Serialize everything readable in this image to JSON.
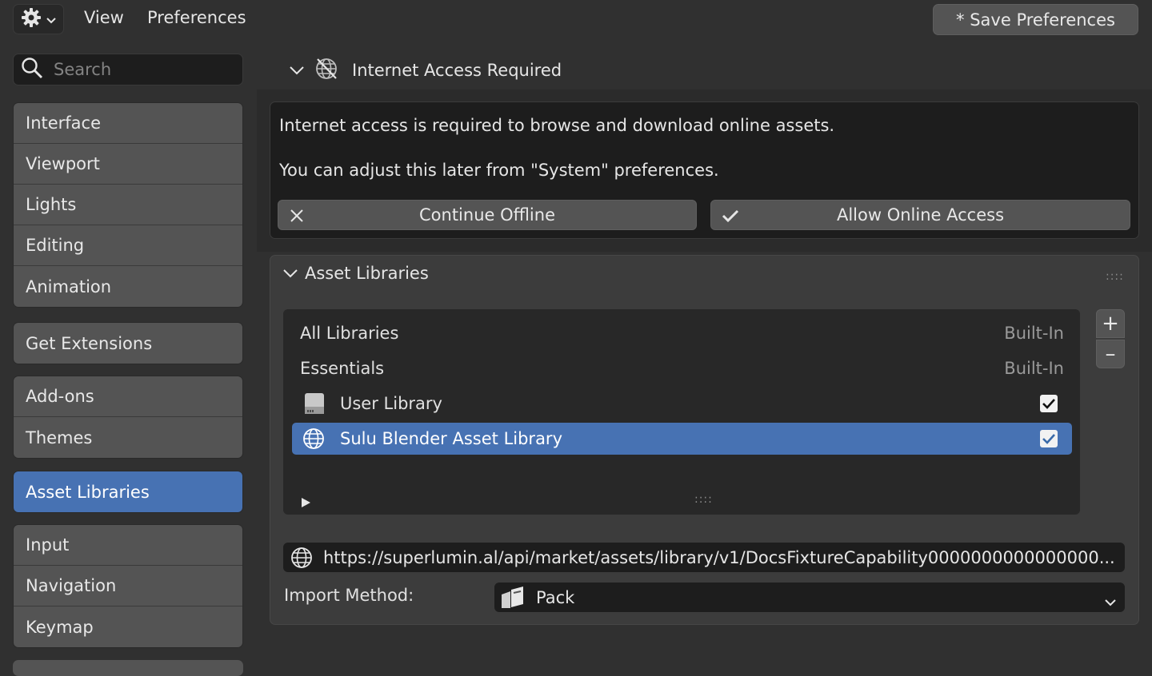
{
  "menu": {
    "gear_icon": "gear-icon",
    "view": "View",
    "preferences": "Preferences",
    "save_preferences": "* Save Preferences"
  },
  "search": {
    "placeholder": "Search"
  },
  "sidebar": {
    "group1": [
      "Interface",
      "Viewport",
      "Lights",
      "Editing",
      "Animation"
    ],
    "group2": [
      "Get Extensions"
    ],
    "group3": [
      "Add-ons",
      "Themes"
    ],
    "group4": [
      "Asset Libraries"
    ],
    "group5": [
      "Input",
      "Navigation",
      "Keymap"
    ],
    "active": "Asset Libraries"
  },
  "internet_access": {
    "title": "Internet Access Required",
    "line1": "Internet access is required to browse and download online assets.",
    "line2": "You can adjust this later from \"System\" preferences.",
    "continue_offline": "Continue Offline",
    "allow_online": "Allow Online Access"
  },
  "asset_libraries": {
    "title": "Asset Libraries",
    "libraries": [
      {
        "name": "All Libraries",
        "tag": "Built-In"
      },
      {
        "name": "Essentials",
        "tag": "Built-In"
      },
      {
        "name": "User Library",
        "icon": "drive-icon",
        "enabled": true
      },
      {
        "name": "Sulu Blender Asset Library",
        "icon": "globe-icon",
        "enabled": true,
        "selected": true
      }
    ],
    "add": "+",
    "remove": "–",
    "url": "https://superlumin.al/api/market/assets/library/v1/DocsFixtureCapability0000000000000000...",
    "import_label": "Import Method:",
    "import_value": "Pack"
  },
  "colors": {
    "accent": "#4772b3",
    "background": "#303030",
    "button": "#545454"
  }
}
